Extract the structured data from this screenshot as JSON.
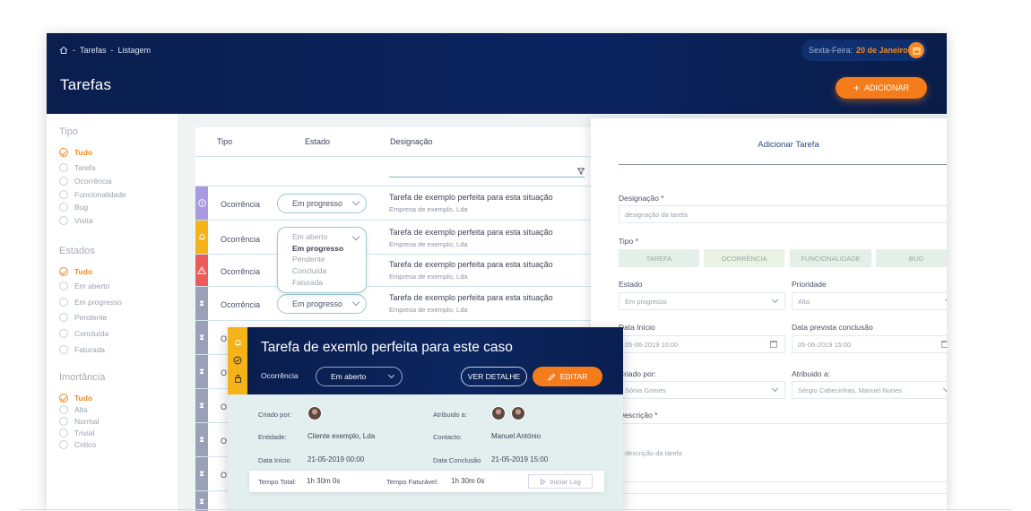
{
  "header": {
    "breadcrumb": [
      "Tarefas",
      "Listagem"
    ],
    "separator": "-",
    "page_title": "Tarefas",
    "date_prefix": "Sexta-Feira:",
    "date_value": "20 de Janeiro",
    "add_button": "ADICIONAR"
  },
  "sidebar": {
    "tipo": {
      "title": "Tipo",
      "options": [
        "Tudo",
        "Tarefa",
        "Ocorrência",
        "Funcionalidade",
        "Bug",
        "Visita"
      ],
      "selected": "Tudo"
    },
    "estados": {
      "title": "Estados",
      "options": [
        "Tudo",
        "Em aberto",
        "Em progresso",
        "Pendente",
        "Concluída",
        "Faturada"
      ],
      "selected": "Tudo"
    },
    "importancia": {
      "title": "Imortância",
      "options": [
        "Tudo",
        "Alta",
        "Normal",
        "Trivial",
        "Critico"
      ],
      "selected": "Tudo"
    }
  },
  "table": {
    "columns": [
      "Tipo",
      "Estado",
      "Designação"
    ],
    "rows": [
      {
        "type": "Ocorrência",
        "estado": "Em progresso",
        "designacao": "Tarefa de exemplo perfeita para esta situação",
        "empresa": "Empresa de exemplo, Lda",
        "color": "#a99ae0",
        "icon": "!"
      },
      {
        "type": "Ocorrência",
        "estado": "",
        "designacao": "Tarefa de exemplo perfeita para esta situação",
        "empresa": "Empresa de exemplo, Lda",
        "color": "#f5b31a",
        "icon": "bell"
      },
      {
        "type": "Ocorrência",
        "estado": "",
        "designacao": "Tarefa de exemplo perfeita para esta situação",
        "empresa": "Empresa de exemplo, Lda",
        "color": "#ec5b5b",
        "icon": "⚠"
      },
      {
        "type": "Ocorrência",
        "estado": "Em progresso",
        "designacao": "Tarefa de exemplo perfeita para esta situação",
        "empresa": "Empresa de exemplo, Lda",
        "color": "#9aa0b6",
        "icon": "⧗"
      }
    ],
    "partial_rows_label": "O",
    "dropdown_options": [
      "Em aberto",
      "Em progresso",
      "Pendente",
      "Concluída",
      "Faturada"
    ],
    "dropdown_selected": "Em progresso"
  },
  "add_panel": {
    "title": "Adicionar Tarefa",
    "designacao_label": "Designação *",
    "designacao_placeholder": "designação da tarefa",
    "tipo_label": "Tipo *",
    "tipo_options": [
      "TAREFA",
      "OCORRÊNCIA",
      "FUNCIONALIDADE",
      "BUG"
    ],
    "estado_label": "Estado",
    "estado_value": "Em progresso",
    "prioridade_label": "Prioridade",
    "prioridade_value": "Alta",
    "data_inicio_label": "Data Início",
    "data_inicio_value": "05-06-2019 10:00",
    "data_prevista_label": "Data prevista conclusão",
    "data_prevista_value": "05-06-2019 15:00",
    "criado_label": "Criado por:",
    "criado_value": "Sónia Gomes",
    "atribuido_label": "Atribuido a:",
    "atribuido_value": "Sérgio Cabecinhas, Manuel Nunes",
    "descricao_label": "Descrição *",
    "descricao_placeholder": "descrição da tarefa"
  },
  "card": {
    "title": "Tarefa de exemlo perfeita para este caso",
    "type": "Ocorrência",
    "estado": "Em aberto",
    "ver_detalhe": "VER DETALHE",
    "editar": "EDITAR",
    "criado_label": "Criado por:",
    "atribuido_label": "Atribuido a:",
    "entidade_label": "Entidade:",
    "entidade_value": "Cliente exemplo, Lda",
    "contacto_label": "Contacto:",
    "contacto_value": "Manuel António",
    "data_inicio_label": "Data Início",
    "data_inicio_value": "21-05-2019 00:00",
    "data_conclusao_label": "Data Conclusão",
    "data_conclusao_value": "21-05-2019 15:00",
    "tempo_total_label": "Tempo Total:",
    "tempo_total_value": "1h 30m 0s",
    "tempo_faturavel_label": "Tempo Faturável:",
    "tempo_faturavel_value": "1h 30m 0s",
    "iniciar_log": "Iniciar Log"
  },
  "colors": {
    "accent": "#f57c1a",
    "header": "#0b2460",
    "teal_line": "#9bc7cf"
  }
}
